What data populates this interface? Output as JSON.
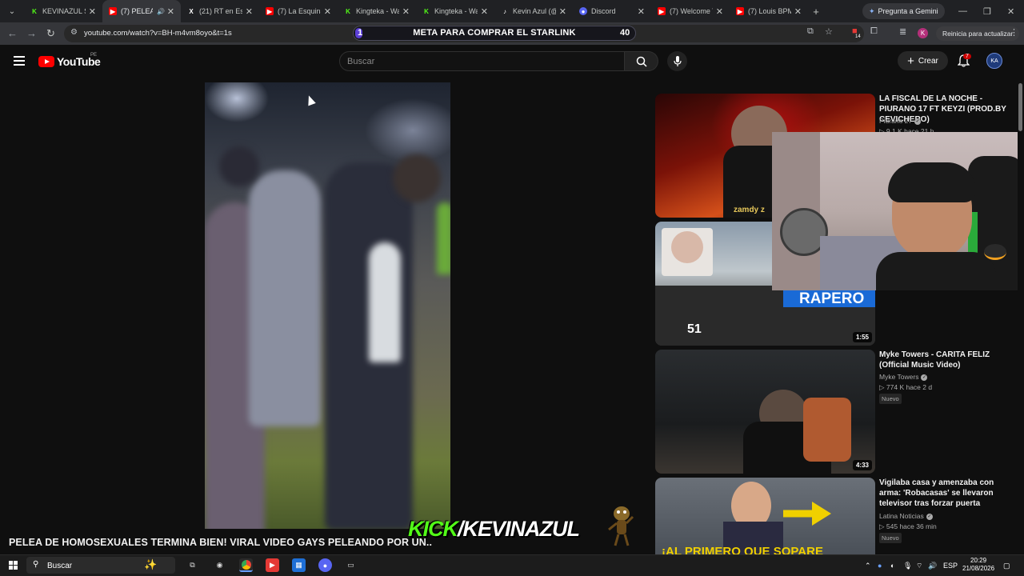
{
  "browser": {
    "tabs": [
      {
        "label": "KEVINAZUL St",
        "icon": "kick-icon"
      },
      {
        "label": "(7) PELEA D",
        "icon": "youtube-icon",
        "active": true
      },
      {
        "label": "(21) RT en Esp",
        "icon": "x-icon"
      },
      {
        "label": "(7) La Esquina",
        "icon": "youtube-icon"
      },
      {
        "label": "Kingteka - Wa",
        "icon": "kick-icon"
      },
      {
        "label": "Kingteka - Wa",
        "icon": "kick-icon"
      },
      {
        "label": "Kevin Azul (@",
        "icon": "tiktok-icon"
      },
      {
        "label": "Discord",
        "icon": "discord-icon"
      },
      {
        "label": "(7) Welcome T",
        "icon": "youtube-icon"
      },
      {
        "label": "(7) Louis BPM",
        "icon": "youtube-icon"
      }
    ],
    "gemini_label": "Pregunta a Gemini",
    "url": "youtube.com/watch?v=BH-m4vm8oyo&t=1s",
    "update_label": "Reinicia para actualizar",
    "profile_initial": "K",
    "extension_badge": "14"
  },
  "meta_overlay": {
    "label": "META PARA COMPRAR EL STARLINK",
    "current": "1",
    "goal": "40",
    "progress_fraction": 0.025
  },
  "youtube": {
    "logo_text": "YouTube",
    "country_code": "PE",
    "search_placeholder": "Buscar",
    "create_label": "Crear",
    "notification_count": "7",
    "video_title": "PELEA DE HOMOSEXUALES TERMINA BIEN! VIRAL VIDEO GAYS PELEANDO POR UN.."
  },
  "stream_overlay": {
    "kick_prefix": "KICK",
    "kick_suffix": "/KEVINAZUL"
  },
  "related": [
    {
      "title": "LA FISCAL DE LA NOCHE - PIURANO 17 FT KEYZI (PROD.BY CEVICHERO)",
      "channel": "Piurano 27",
      "verified": true,
      "meta": "▷ 9.1 K  hace 21 h",
      "thumb_text": "zamdy z",
      "duration": "",
      "new": false
    },
    {
      "title": "",
      "channel": "",
      "verified": false,
      "meta": "",
      "thumb_text": "RAPERO",
      "thumb_logo": "51",
      "duration": "1:55",
      "new": false
    },
    {
      "title": "Myke Towers - CARITA FELIZ (Official Music Video)",
      "channel": "Myke Towers",
      "verified": true,
      "meta": "▷ 774 K  hace 2 d",
      "duration": "4:33",
      "new": true
    },
    {
      "title": "Vigilaba casa y amenzaba con arma: 'Robacasas' se llevaron televisor tras forzar puerta",
      "channel": "Latina Noticias",
      "verified": true,
      "meta": "▷ 545  hace 36 min",
      "thumb_text": "¡AL PRIMERO QUE SOPARE",
      "duration": "",
      "new": true
    }
  ],
  "new_badge": "Nuevo",
  "taskbar": {
    "search_label": "Buscar",
    "language": "ESP",
    "time": "20:29",
    "date": "21/08/2026"
  }
}
